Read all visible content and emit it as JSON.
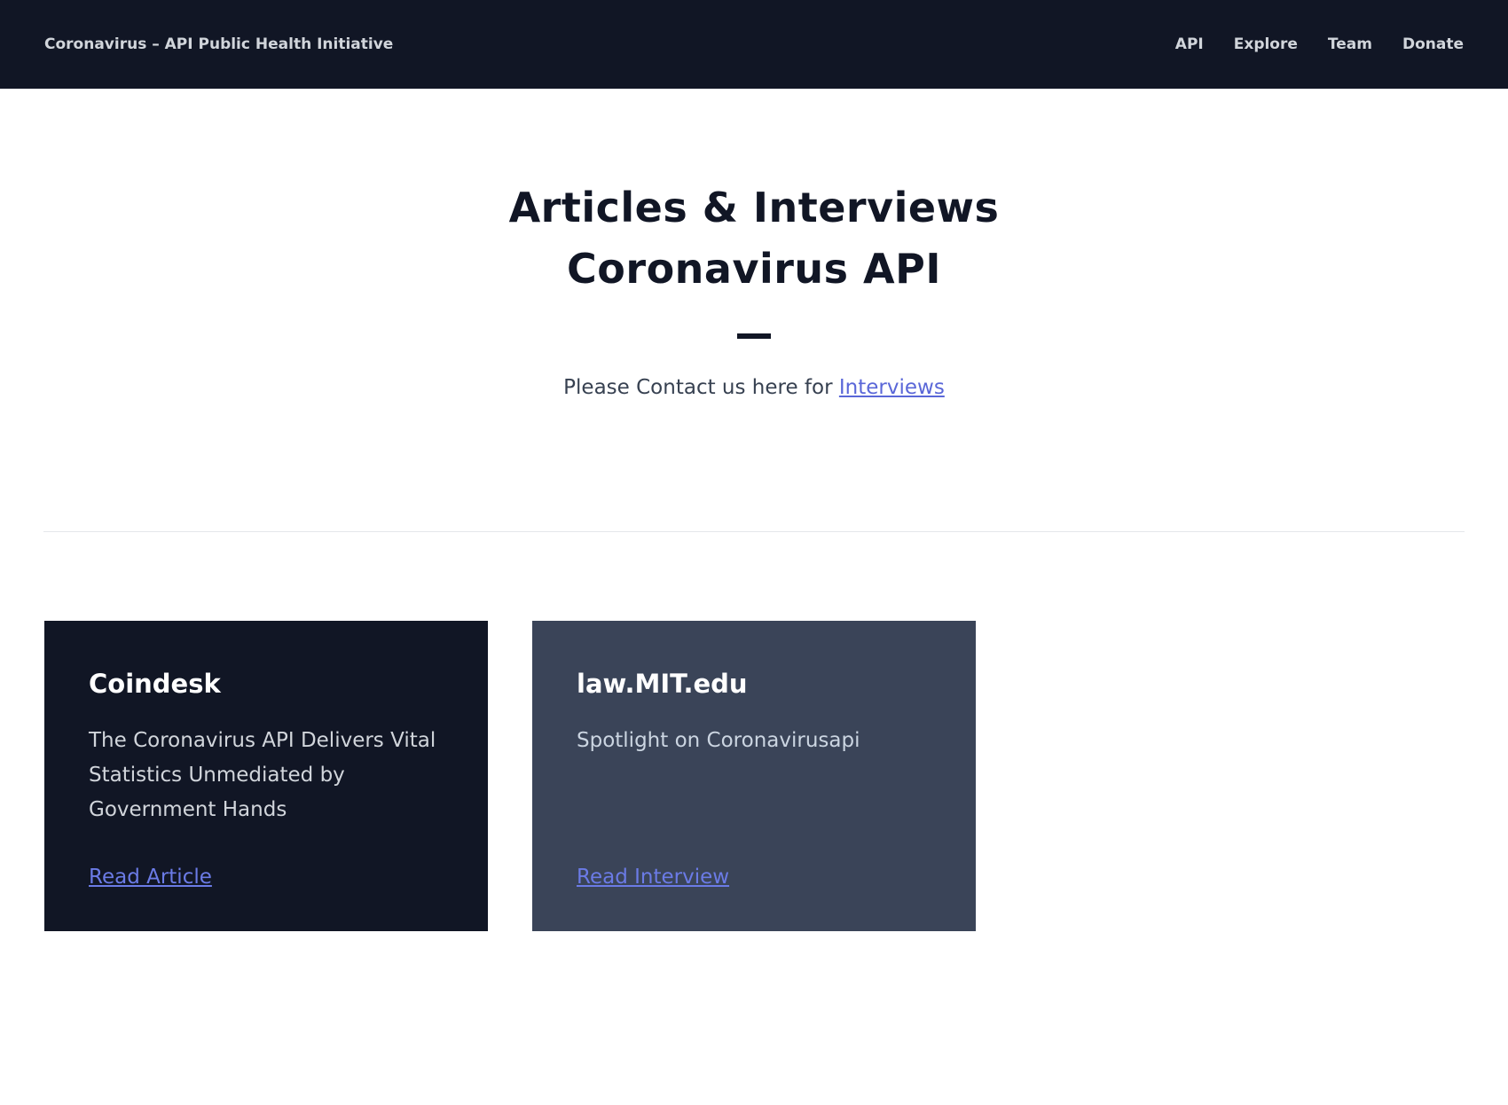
{
  "navbar": {
    "brand": "Coronavirus – API Public Health Initiative",
    "links": [
      "API",
      "Explore",
      "Team",
      "Donate"
    ]
  },
  "hero": {
    "title_line1": "Articles & Interviews",
    "title_line2": "Coronavirus API",
    "contact_prefix": "Please Contact us here for ",
    "contact_link": "Interviews"
  },
  "cards": [
    {
      "title": "Coindesk",
      "description": "The Coronavirus API Delivers Vital Statistics Unmediated by Government Hands",
      "link_label": "Read Article"
    },
    {
      "title": "law.MIT.edu",
      "description": "Spotlight on Coronavirusapi",
      "link_label": "Read Interview"
    }
  ],
  "colors": {
    "navbar_bg": "#111625",
    "card_dark": "#111625",
    "card_slate": "#3a4458",
    "link": "#5a67d8"
  }
}
